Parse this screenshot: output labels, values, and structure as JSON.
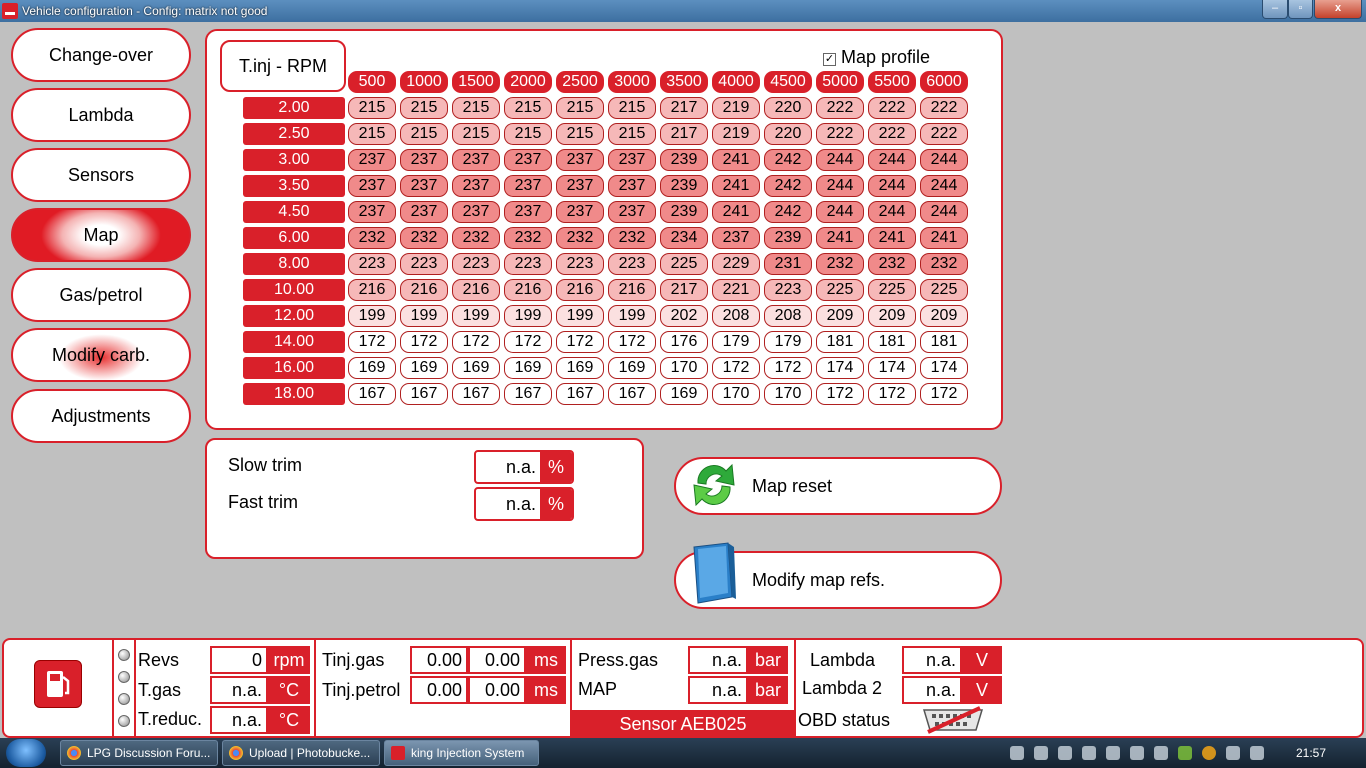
{
  "window": {
    "title": "Vehicle configuration - Config: matrix not good",
    "min_label": "–",
    "max_label": "▫",
    "close_label": "x"
  },
  "nav": {
    "items": [
      {
        "label": "Change-over",
        "state": "normal"
      },
      {
        "label": "Lambda",
        "state": "normal"
      },
      {
        "label": "Sensors",
        "state": "normal"
      },
      {
        "label": "Map",
        "state": "active"
      },
      {
        "label": "Gas/petrol",
        "state": "normal"
      },
      {
        "label": "Modify carb.",
        "state": "highlight"
      },
      {
        "label": "Adjustments",
        "state": "normal"
      }
    ]
  },
  "map": {
    "title": "T.inj - RPM",
    "profile_label": "Map profile",
    "profile_checked": true,
    "rpm": [
      "500",
      "1000",
      "1500",
      "2000",
      "2500",
      "3000",
      "3500",
      "4000",
      "4500",
      "5000",
      "5500",
      "6000"
    ],
    "rows": [
      {
        "tinj": "2.00",
        "values": [
          215,
          215,
          215,
          215,
          215,
          215,
          217,
          219,
          220,
          222,
          222,
          222
        ]
      },
      {
        "tinj": "2.50",
        "values": [
          215,
          215,
          215,
          215,
          215,
          215,
          217,
          219,
          220,
          222,
          222,
          222
        ]
      },
      {
        "tinj": "3.00",
        "values": [
          237,
          237,
          237,
          237,
          237,
          237,
          239,
          241,
          242,
          244,
          244,
          244
        ]
      },
      {
        "tinj": "3.50",
        "values": [
          237,
          237,
          237,
          237,
          237,
          237,
          239,
          241,
          242,
          244,
          244,
          244
        ]
      },
      {
        "tinj": "4.50",
        "values": [
          237,
          237,
          237,
          237,
          237,
          237,
          239,
          241,
          242,
          244,
          244,
          244
        ]
      },
      {
        "tinj": "6.00",
        "values": [
          232,
          232,
          232,
          232,
          232,
          232,
          234,
          237,
          239,
          241,
          241,
          241
        ]
      },
      {
        "tinj": "8.00",
        "values": [
          223,
          223,
          223,
          223,
          223,
          223,
          225,
          229,
          231,
          232,
          232,
          232
        ]
      },
      {
        "tinj": "10.00",
        "values": [
          216,
          216,
          216,
          216,
          216,
          216,
          217,
          221,
          223,
          225,
          225,
          225
        ]
      },
      {
        "tinj": "12.00",
        "values": [
          199,
          199,
          199,
          199,
          199,
          199,
          202,
          208,
          208,
          209,
          209,
          209
        ]
      },
      {
        "tinj": "14.00",
        "values": [
          172,
          172,
          172,
          172,
          172,
          172,
          176,
          179,
          179,
          181,
          181,
          181
        ]
      },
      {
        "tinj": "16.00",
        "values": [
          169,
          169,
          169,
          169,
          169,
          169,
          170,
          172,
          172,
          174,
          174,
          174
        ]
      },
      {
        "tinj": "18.00",
        "values": [
          167,
          167,
          167,
          167,
          167,
          167,
          169,
          170,
          170,
          172,
          172,
          172
        ]
      }
    ],
    "colors": {
      "hot": "#f08a8a",
      "warm": "#f6b8b8",
      "cool": "#fbe0e0",
      "cold": "#ffffff",
      "accent": "#d9202a"
    }
  },
  "trim": {
    "slow_label": "Slow trim",
    "slow_value": "n.a.",
    "slow_unit": "%",
    "fast_label": "Fast trim",
    "fast_value": "n.a.",
    "fast_unit": "%"
  },
  "actions": {
    "reset_label": "Map reset",
    "reset_icon": "recycle-arrows-icon",
    "modify_label": "Modify map refs.",
    "modify_icon": "blue-book-icon"
  },
  "status": {
    "revs_label": "Revs",
    "revs_value": "0",
    "revs_unit": "rpm",
    "tgas_label": "T.gas",
    "tgas_value": "n.a.",
    "tgas_unit": "°C",
    "treduc_label": "T.reduc.",
    "treduc_value": "n.a.",
    "treduc_unit": "°C",
    "tinj_gas_label": "Tinj.gas",
    "tinj_gas_v1": "0.00",
    "tinj_gas_v2": "0.00",
    "tinj_gas_unit": "ms",
    "tinj_petrol_label": "Tinj.petrol",
    "tinj_petrol_v1": "0.00",
    "tinj_petrol_v2": "0.00",
    "tinj_petrol_unit": "ms",
    "press_gas_label": "Press.gas",
    "press_gas_value": "n.a.",
    "press_gas_unit": "bar",
    "map_label": "MAP",
    "map_value": "n.a.",
    "map_unit": "bar",
    "sensor_label": "Sensor AEB025",
    "lambda_label": "Lambda",
    "lambda_value": "n.a.",
    "lambda_unit": "V",
    "lambda2_label": "Lambda 2",
    "lambda2_value": "n.a.",
    "lambda2_unit": "V",
    "obd_label": "OBD status",
    "obd_icon": "obd-disconnected-icon"
  },
  "taskbar": {
    "tasks": [
      {
        "label": "LPG Discussion Foru...",
        "icon": "chrome-icon"
      },
      {
        "label": "Upload | Photobucke...",
        "icon": "chrome-icon"
      },
      {
        "label": "king Injection System",
        "icon": "king-app-icon"
      }
    ],
    "clock": "21:57"
  }
}
